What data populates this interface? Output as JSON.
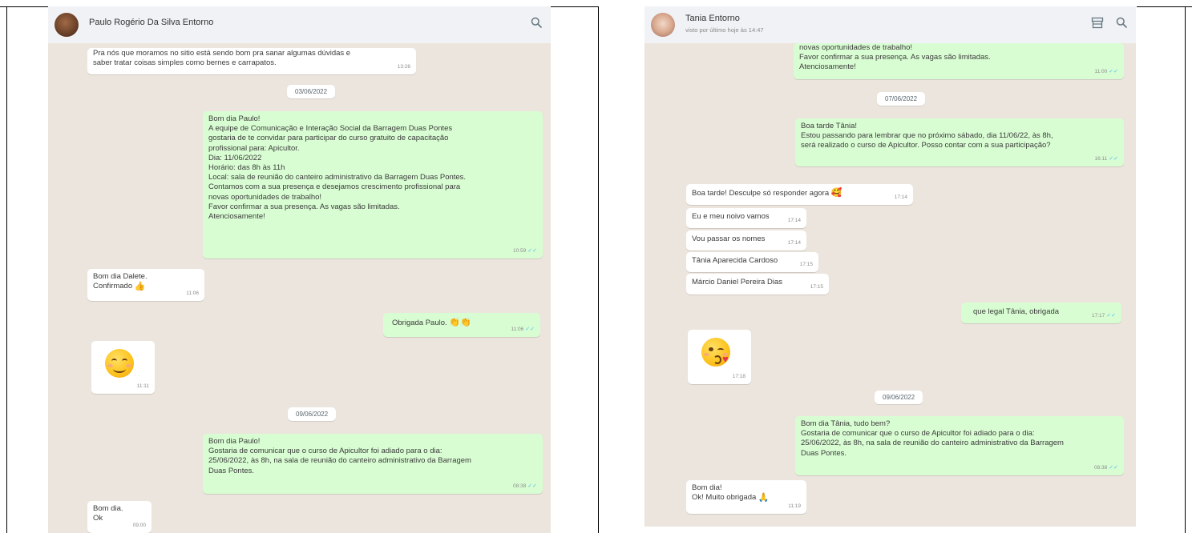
{
  "left_chat": {
    "contact_name": "Paulo Rogério Da Silva Entorno",
    "messages": [
      {
        "dir": "in",
        "lines": [
          "Pra nós que moramos no sitio está sendo bom pra sanar algumas dúvidas e",
          "saber tratar coisas simples como bernes e carrapatos."
        ],
        "time": "13:26"
      },
      {
        "dir": "date",
        "text": "03/06/2022"
      },
      {
        "dir": "out",
        "lines": [
          "Bom dia Paulo!",
          "A equipe de Comunicação e Interação Social da Barragem Duas Pontes",
          "gostaria de te convidar para participar do curso gratuito de capacitação",
          "profissional para: Apicultor.",
          "Dia: 11/06/2022",
          "Horário: das 8h às 11h",
          "Local: sala de reunião do canteiro administrativo da Barragem Duas Pontes.",
          "Contamos com a sua presença e desejamos crescimento profissional para",
          "novas oportunidades de trabalho!",
          "Favor confirmar a sua presença. As vagas são limitadas.",
          "Atenciosamente!"
        ],
        "time": "10:59"
      },
      {
        "dir": "in",
        "lines": [
          "Bom dia Dalete.",
          "Confirmado"
        ],
        "time": "11:06",
        "emoji": "thumbs-up"
      },
      {
        "dir": "out",
        "lines": [
          "Obrigada Paulo."
        ],
        "time": "11:06",
        "emoji": "clapping-hands"
      },
      {
        "dir": "in",
        "emoji_only": "smiling-face",
        "time": "11:11"
      },
      {
        "dir": "date",
        "text": "09/06/2022"
      },
      {
        "dir": "out",
        "lines": [
          "Bom dia Paulo!",
          "Gostaria de comunicar que o curso de Apicultor foi adiado para o dia:",
          "25/06/2022, às 8h, na sala de reunião do canteiro administrativo da Barragem",
          "Duas Pontes."
        ],
        "time": "08:38"
      },
      {
        "dir": "in",
        "lines": [
          "Bom dia.",
          "Ok"
        ],
        "time": "09:00"
      }
    ]
  },
  "right_chat": {
    "contact_name": "Tania Entorno",
    "last_seen": "visto por último hoje às 14:47",
    "messages": [
      {
        "dir": "out",
        "lines": [
          "novas oportunidades de trabalho!",
          "Favor confirmar a sua presença. As vagas são limitadas.",
          "Atenciosamente!"
        ],
        "time": "11:00"
      },
      {
        "dir": "date",
        "text": "07/06/2022"
      },
      {
        "dir": "out",
        "lines": [
          "Boa tarde Tânia!",
          "Estou passando para lembrar que no próximo sábado, dia 11/06/22, às 8h,",
          "será realizado o curso de Apicultor. Posso contar com a sua participação?"
        ],
        "time": "16:11"
      },
      {
        "dir": "in",
        "lines": [
          "Boa tarde! Desculpe só responder agora"
        ],
        "time": "17:14",
        "emoji": "smiling-face-with-hearts"
      },
      {
        "dir": "in",
        "lines": [
          "Eu e meu noivo vamos"
        ],
        "time": "17:14"
      },
      {
        "dir": "in",
        "lines": [
          "Vou passar os nomes"
        ],
        "time": "17:14"
      },
      {
        "dir": "in",
        "lines": [
          "Tânia Aparecida Cardoso"
        ],
        "time": "17:15"
      },
      {
        "dir": "in",
        "lines": [
          "Márcio Daniel Pereira Dias"
        ],
        "time": "17:15"
      },
      {
        "dir": "out",
        "lines": [
          "que legal Tânia, obrigada"
        ],
        "time": "17:17"
      },
      {
        "dir": "in",
        "emoji_only": "face-blowing-kiss",
        "time": "17:18"
      },
      {
        "dir": "date",
        "text": "09/06/2022"
      },
      {
        "dir": "out",
        "lines": [
          "Bom dia Tânia, tudo bem?",
          "Gostaria de comunicar que o curso de Apicultor foi adiado para o dia:",
          "25/06/2022, às 8h, na sala de reunião do canteiro administrativo da Barragem",
          "Duas Pontes."
        ],
        "time": "08:38"
      },
      {
        "dir": "in",
        "lines": [
          "Bom dia!",
          "Ok! Muito obrigada"
        ],
        "time": "11:19",
        "emoji": "folded-hands"
      }
    ]
  },
  "icons": {
    "search": "search-icon",
    "store": "store-icon"
  },
  "colors": {
    "incoming": "#ffffff",
    "outgoing": "#d9fdd3",
    "chat_bg": "#ece5dd",
    "header": "#f0f2f5",
    "ticks": "#53bdeb"
  }
}
